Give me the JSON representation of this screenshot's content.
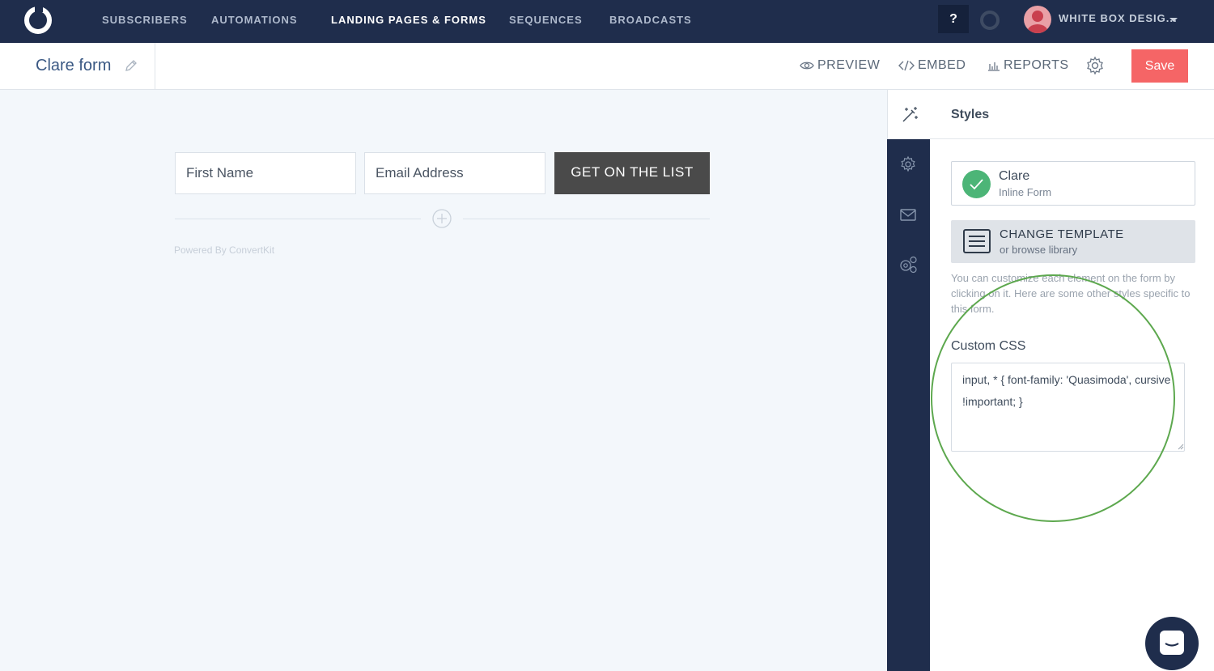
{
  "nav": {
    "items": [
      {
        "label": "SUBSCRIBERS",
        "active": false
      },
      {
        "label": "AUTOMATIONS",
        "active": false
      },
      {
        "label": "LANDING PAGES & FORMS",
        "active": true
      },
      {
        "label": "SEQUENCES",
        "active": false
      },
      {
        "label": "BROADCASTS",
        "active": false
      }
    ],
    "help_label": "?",
    "account_label": "WHITE BOX DESIG..."
  },
  "toolbar": {
    "form_title": "Clare form",
    "preview_label": "PREVIEW",
    "embed_label": "EMBED",
    "reports_label": "REPORTS",
    "save_label": "Save"
  },
  "form": {
    "first_name_placeholder": "First Name",
    "email_placeholder": "Email Address",
    "cta_label": "GET ON THE LIST",
    "powered_by": "Powered By ConvertKit"
  },
  "panel": {
    "title": "Styles",
    "template_name": "Clare",
    "template_type": "Inline Form",
    "change_template_label": "CHANGE TEMPLATE",
    "change_template_sub": "or browse library",
    "help_text": "You can customize each element on the form by clicking on it. Here are some other styles specific to this form.",
    "custom_css_label": "Custom CSS",
    "custom_css_value": "input, * { font-family: 'Quasimoda', cursive !important; }"
  },
  "colors": {
    "nav_bg": "#1f2d4c",
    "save": "#f56566",
    "cta": "#4a4a4a",
    "success": "#4cb577",
    "annotation": "#5da84e"
  }
}
